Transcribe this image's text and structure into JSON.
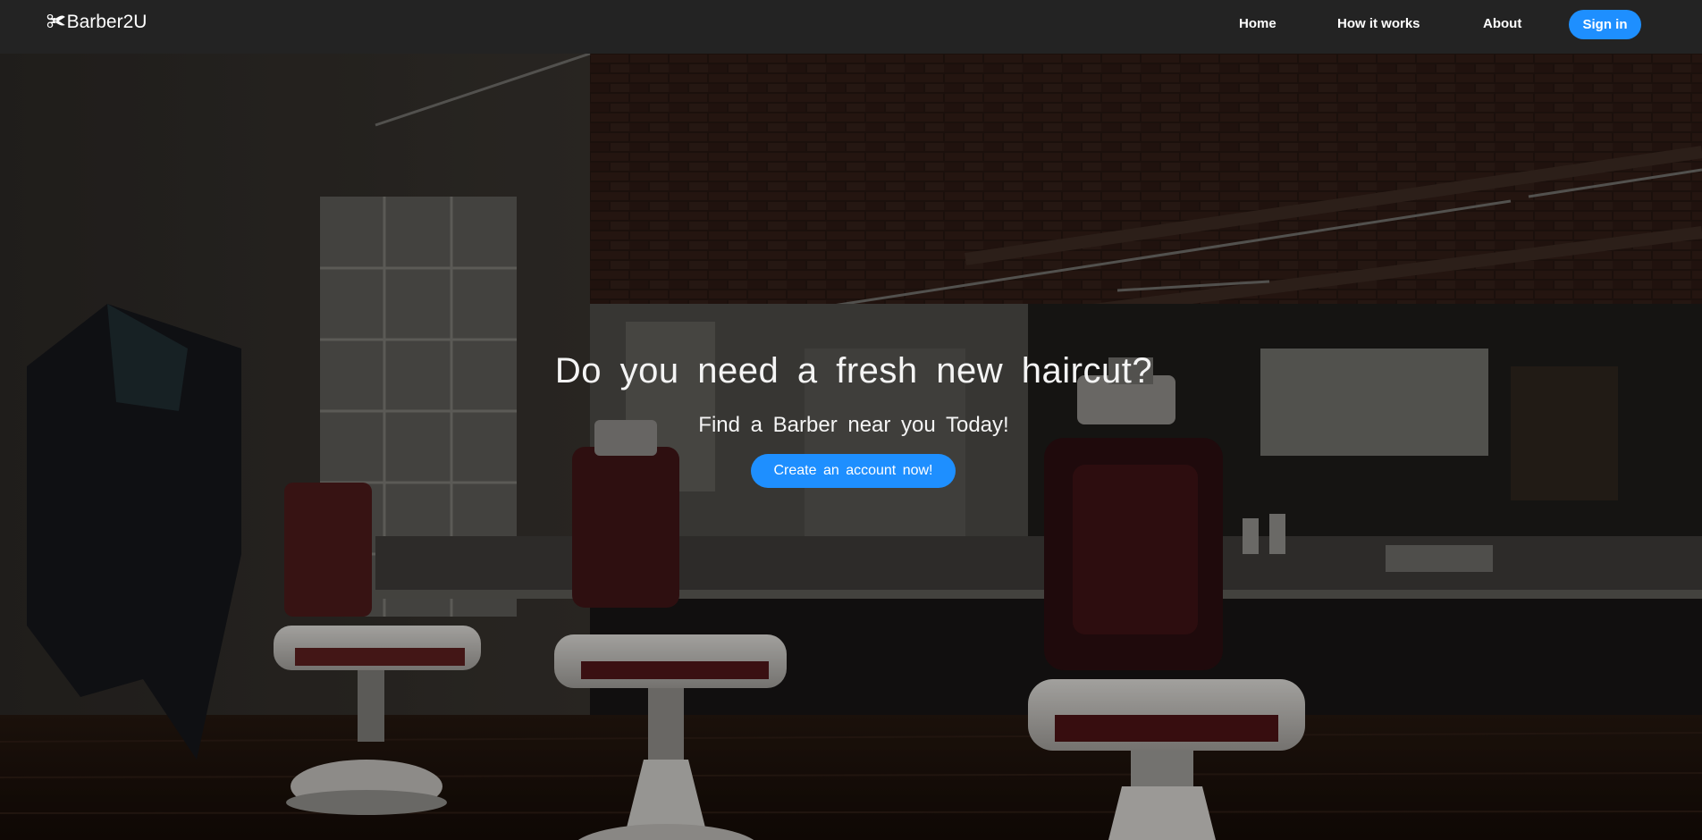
{
  "navbar": {
    "brand_icon": "✀",
    "brand_icon_name": "scissors-icon",
    "brand_text": "Barber2U",
    "links": [
      {
        "label": "Home"
      },
      {
        "label": "How it works"
      },
      {
        "label": "About"
      }
    ],
    "signin_label": "Sign in"
  },
  "hero": {
    "title": "Do you need a fresh new haircut?",
    "subtitle": "Find a Barber near you Today!",
    "cta_label": "Create an account now!",
    "background_image": "barbershop-interior-photo"
  },
  "colors": {
    "navbar_bg": "#232323",
    "accent": "#1e8fff",
    "text": "#ffffff"
  }
}
